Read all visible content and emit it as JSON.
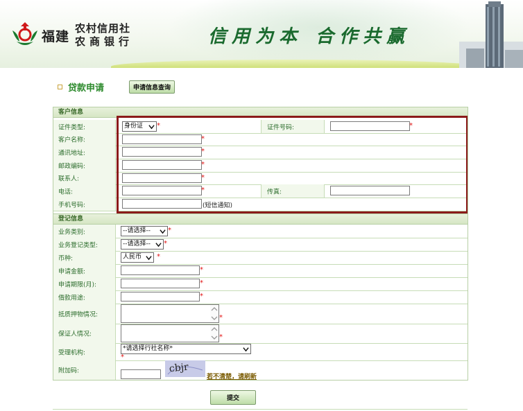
{
  "header": {
    "brand_short": "福建",
    "brand_line1": "农村信用社",
    "brand_line2": "农商银行",
    "slogan_left": "信用为本",
    "slogan_right": "合作共赢"
  },
  "page": {
    "title": "贷款申请",
    "query_button": "申请信息查询"
  },
  "customer_section": {
    "header": "客户信息",
    "id_type_label": "证件类型:",
    "id_type_value": "身份证",
    "id_number_label": "证件号码:",
    "customer_name_label": "客户名称:",
    "address_label": "通讯地址:",
    "postcode_label": "邮政编码:",
    "contact_label": "联系人:",
    "phone_label": "电话:",
    "fax_label": "传真:",
    "mobile_label": "手机号码:",
    "mobile_note": "(短信通知)"
  },
  "register_section": {
    "header": "登记信息",
    "business_type_label": "业务类别:",
    "business_type_value": "--请选择--",
    "register_type_label": "业务登记类型:",
    "register_type_value": "--请选择--",
    "currency_label": "币种:",
    "currency_value": "人民币",
    "amount_label": "申请金额:",
    "term_label": "申请期限(月):",
    "purpose_label": "借款用途:",
    "collateral_label": "抵质押物情况:",
    "guarantor_label": "保证人情况:",
    "institution_label": "受理机构:",
    "institution_value": "*请选择行社名称*",
    "captcha_label": "附加码:",
    "captcha_text": "cbjr",
    "refresh_link": "若不清楚，请刷新"
  },
  "submit_button": "提交",
  "required_mark": "*",
  "colors": {
    "accent_green": "#2e8b2e",
    "required_red": "#e01010",
    "highlight_frame": "#8b1a1a"
  }
}
